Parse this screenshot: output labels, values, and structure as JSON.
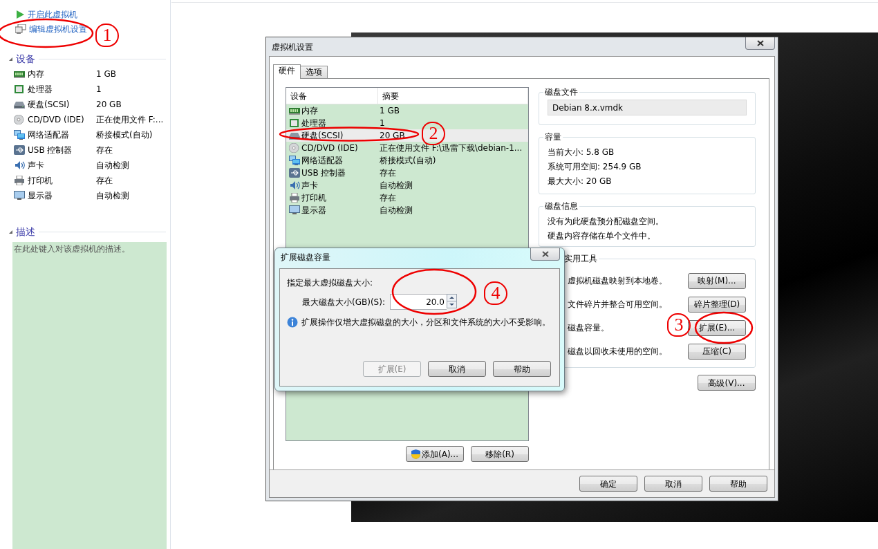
{
  "sidebar": {
    "actions": [
      {
        "kind": "power_on",
        "label": "开启此虚拟机"
      },
      {
        "kind": "edit",
        "label": "编辑虚拟机设置"
      }
    ],
    "devices_heading": "设备",
    "devices": [
      {
        "kind": "memory",
        "name": "内存",
        "summary": "1 GB"
      },
      {
        "kind": "cpu",
        "name": "处理器",
        "summary": "1"
      },
      {
        "kind": "disk",
        "name": "硬盘(SCSI)",
        "summary": "20 GB"
      },
      {
        "kind": "cdrom",
        "name": "CD/DVD (IDE)",
        "summary": "正在使用文件 F:..."
      },
      {
        "kind": "network",
        "name": "网络适配器",
        "summary": "桥接模式(自动)"
      },
      {
        "kind": "usb",
        "name": "USB 控制器",
        "summary": "存在"
      },
      {
        "kind": "sound",
        "name": "声卡",
        "summary": "自动检测"
      },
      {
        "kind": "printer",
        "name": "打印机",
        "summary": "存在"
      },
      {
        "kind": "display",
        "name": "显示器",
        "summary": "自动检测"
      }
    ],
    "description_heading": "描述",
    "description_placeholder": "在此处键入对该虚拟机的描述。"
  },
  "settings_window": {
    "title": "虚拟机设置",
    "tabs": [
      {
        "label": "硬件",
        "selected": true
      },
      {
        "label": "选项",
        "selected": false
      }
    ],
    "device_table": {
      "columns": [
        "设备",
        "摘要"
      ],
      "rows": [
        {
          "kind": "memory",
          "device": "内存",
          "summary": "1 GB",
          "selected": false
        },
        {
          "kind": "cpu",
          "device": "处理器",
          "summary": "1",
          "selected": false
        },
        {
          "kind": "disk",
          "device": "硬盘(SCSI)",
          "summary": "20 GB",
          "selected": true
        },
        {
          "kind": "cdrom",
          "device": "CD/DVD (IDE)",
          "summary": "正在使用文件 F:\\迅雷下载\\debian-1...",
          "selected": false
        },
        {
          "kind": "network",
          "device": "网络适配器",
          "summary": "桥接模式(自动)",
          "selected": false
        },
        {
          "kind": "usb",
          "device": "USB 控制器",
          "summary": "存在",
          "selected": false
        },
        {
          "kind": "sound",
          "device": "声卡",
          "summary": "自动检测",
          "selected": false
        },
        {
          "kind": "printer",
          "device": "打印机",
          "summary": "存在",
          "selected": false
        },
        {
          "kind": "display",
          "device": "显示器",
          "summary": "自动检测",
          "selected": false
        }
      ]
    },
    "list_buttons": [
      {
        "kind": "admin",
        "label": "添加(A)..."
      },
      {
        "kind": "plain",
        "label": "移除(R)"
      }
    ],
    "disk_file": {
      "heading": "磁盘文件",
      "value": "Debian 8.x.vmdk"
    },
    "capacity": {
      "heading": "容量",
      "lines": [
        "当前大小: 5.8 GB",
        "系统可用空间: 254.9 GB",
        "最大大小: 20 GB"
      ]
    },
    "disk_info": {
      "heading": "磁盘信息",
      "lines": [
        "没有为此硬盘预分配磁盘空间。",
        "硬盘内容存储在单个文件中。"
      ]
    },
    "utilities": {
      "heading": "实用工具",
      "rows": [
        {
          "text": "虚拟机磁盘映射到本地卷。",
          "button": "映射(M)..."
        },
        {
          "text": "文件碎片并整合可用空间。",
          "button": "碎片整理(D)"
        },
        {
          "text": "磁盘容量。",
          "button": "扩展(E)..."
        },
        {
          "text": "磁盘以回收未使用的空间。",
          "button": "压缩(C)"
        }
      ]
    },
    "advanced_button": "高级(V)...",
    "footer_buttons": [
      "确定",
      "取消",
      "帮助"
    ]
  },
  "expand_dialog": {
    "title": "扩展磁盘容量",
    "prompt": "指定最大虚拟磁盘大小:",
    "size_label": "最大磁盘大小(GB)(S):",
    "size_value": "20.0",
    "note": "扩展操作仅增大虚拟磁盘的大小，分区和文件系统的大小不受影响。",
    "buttons": [
      {
        "label": "扩展(E)",
        "disabled": true
      },
      {
        "label": "取消",
        "disabled": false
      },
      {
        "label": "帮助",
        "disabled": false
      }
    ]
  },
  "annotations": [
    {
      "label": "1"
    },
    {
      "label": "2"
    },
    {
      "label": "3"
    },
    {
      "label": "4"
    }
  ]
}
